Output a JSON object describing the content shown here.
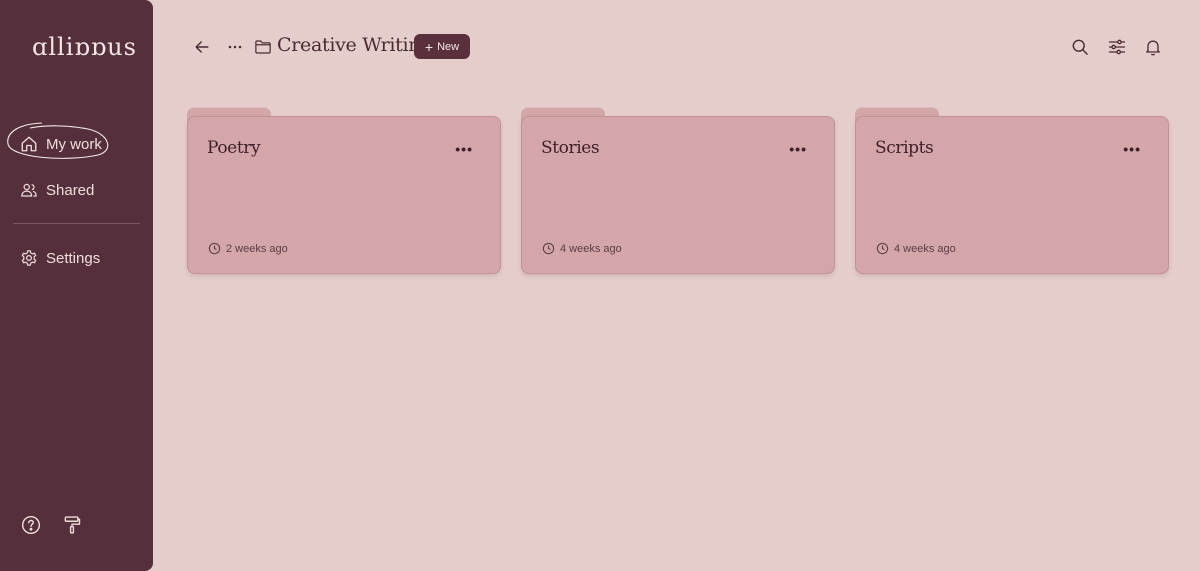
{
  "app": {
    "logo": "ɑlliɒɒus"
  },
  "sidebar": {
    "items": [
      {
        "label": "My work",
        "icon": "home-icon"
      },
      {
        "label": "Shared",
        "icon": "users-icon"
      },
      {
        "label": "Settings",
        "icon": "gear-icon"
      }
    ],
    "bottom_icons": [
      "help-icon",
      "paint-roller-icon"
    ]
  },
  "header": {
    "title": "Creative Writing",
    "new_label": "New",
    "icons": [
      "back-arrow-icon",
      "more-icon",
      "folder-icon",
      "search-icon",
      "filter-icon",
      "bell-icon"
    ]
  },
  "folders": [
    {
      "name": "Poetry",
      "time": "2 weeks ago"
    },
    {
      "name": "Stories",
      "time": "4 weeks ago"
    },
    {
      "name": "Scripts",
      "time": "4 weeks ago"
    }
  ],
  "colors": {
    "background": "#e4cdca",
    "sidebar": "#55303c",
    "folder": "#d4a6a9",
    "accent_button": "#5a303d"
  }
}
